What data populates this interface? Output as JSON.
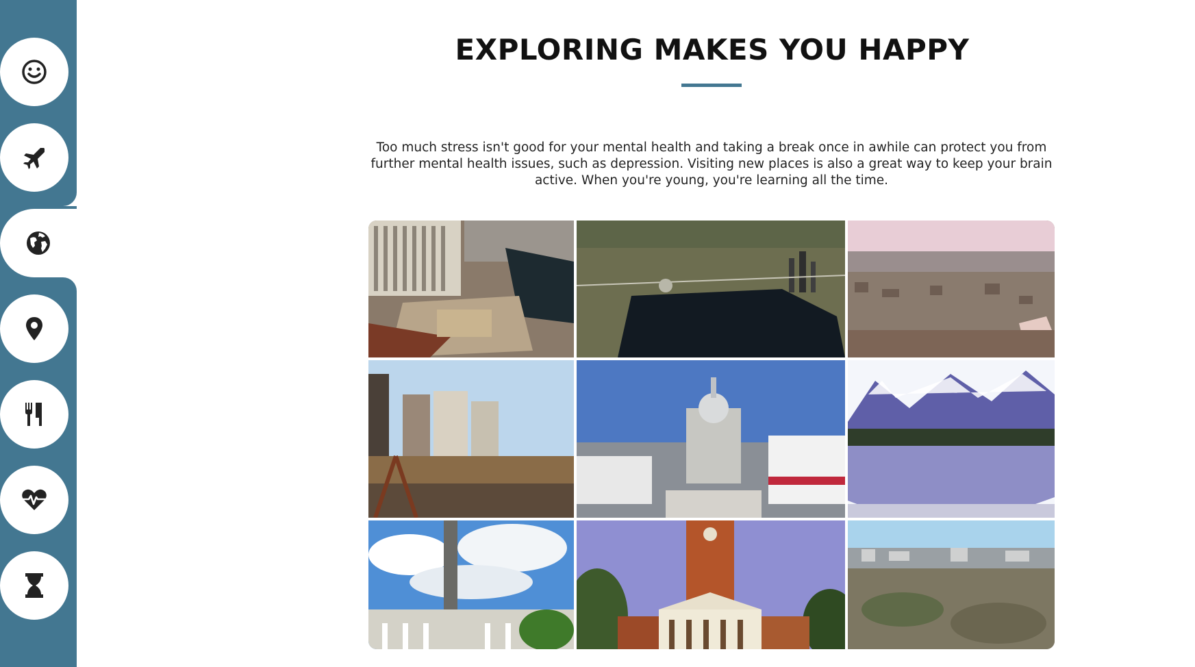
{
  "sidebar": {
    "items": [
      {
        "icon": "smile-icon",
        "active": false
      },
      {
        "icon": "plane-icon",
        "active": false
      },
      {
        "icon": "globe-icon",
        "active": true
      },
      {
        "icon": "map-marker-icon",
        "active": false
      },
      {
        "icon": "utensils-icon",
        "active": false
      },
      {
        "icon": "heartbeat-icon",
        "active": false
      },
      {
        "icon": "hourglass-icon",
        "active": false
      }
    ]
  },
  "main": {
    "title": "EXPLORING MAKES YOU HAPPY",
    "paragraph": "Too much stress isn't good for your mental health and taking a break once in awhile can protect you from further mental health issues, such as depression. Visiting new places is also a great way to keep your brain active. When you're young, you're learning all the time."
  },
  "colors": {
    "accent": "#437791",
    "background": "#ffffff",
    "icon": "#222222",
    "text": "#111111"
  }
}
